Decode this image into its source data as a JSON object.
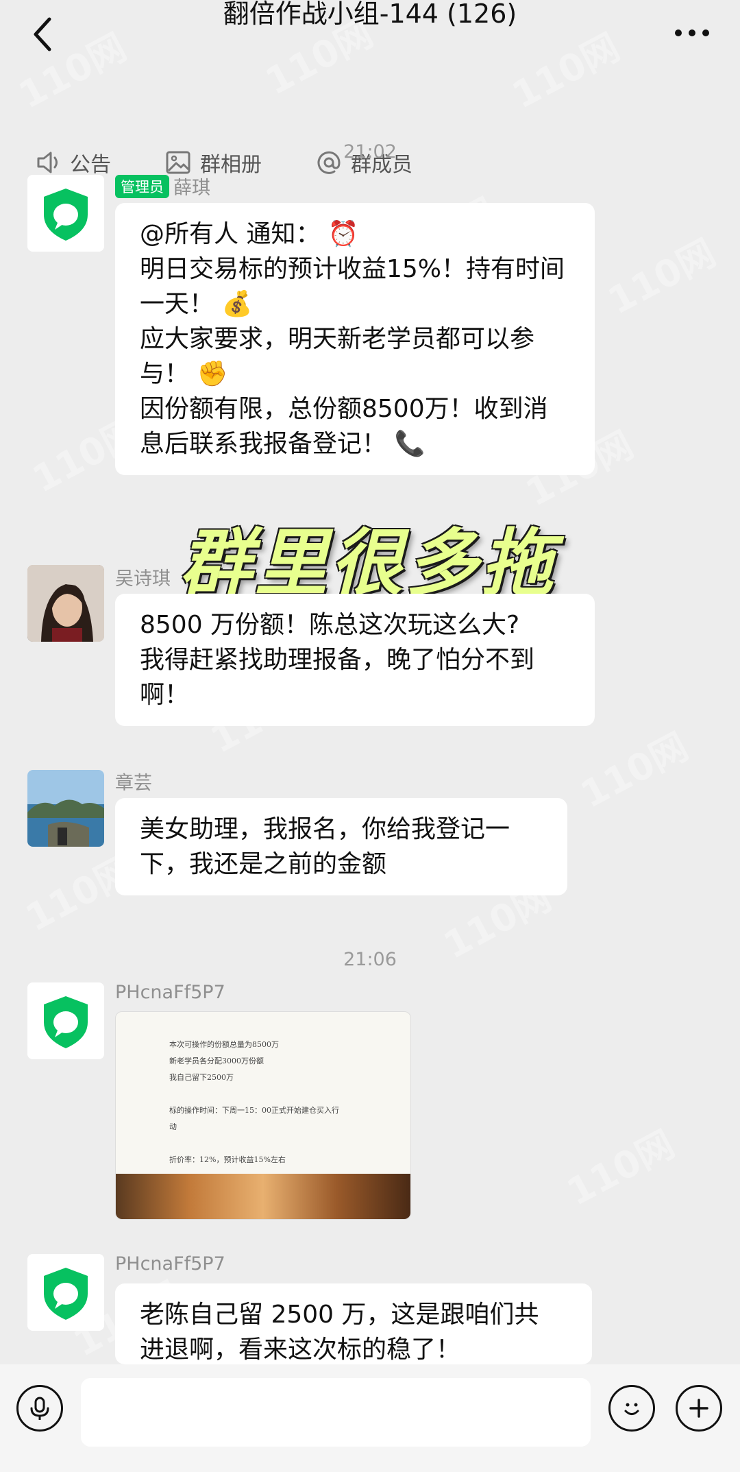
{
  "header": {
    "title": "翻倍作战小组-144 (126)"
  },
  "subbar": {
    "announcement": "公告",
    "album": "群相册",
    "members": "群成员"
  },
  "messages": {
    "time1": "21:02",
    "time2": "21:06",
    "m1": {
      "badge": "管理员",
      "sender": "薛琪",
      "text": "@所有人 通知： ⏰\n明日交易标的预计收益15%！持有时间一天！ 💰\n应大家要求，明天新老学员都可以参与！ ✊\n因份额有限，总份额8500万！收到消息后联系我报备登记！ 📞"
    },
    "m2": {
      "sender": "吴诗琪",
      "text": "8500 万份额！陈总这次玩这么大?\n我得赶紧找助理报备，晚了怕分不到啊！"
    },
    "m3": {
      "sender": "章芸",
      "text": "美女助理，我报名，你给我登记一\n下，我还是之前的金额"
    },
    "m4": {
      "sender": "PHcnaFf5P7",
      "image_lines": [
        "本次可操作的份额总量为8500万",
        "新老学员各分配3000万份额",
        "我自己留下2500万",
        "",
        "标的操作时间：下周一15：00正式开始建仓买入行",
        "动",
        "",
        "折价率：12%，预计收益15%左右"
      ]
    },
    "m5": {
      "sender": "PHcnaFf5P7",
      "text": "老陈自己留 2500 万，这是跟咱们共\n进退啊，看来这次标的稳了！"
    }
  },
  "overlay": {
    "caption": "群里很多拖"
  },
  "watermark": {
    "text": "110网"
  },
  "colors": {
    "background": "#ededed",
    "bubble": "#ffffff",
    "admin_badge": "#07c160",
    "shield": "#07c160",
    "overlay_text": "#e8ff8e"
  }
}
